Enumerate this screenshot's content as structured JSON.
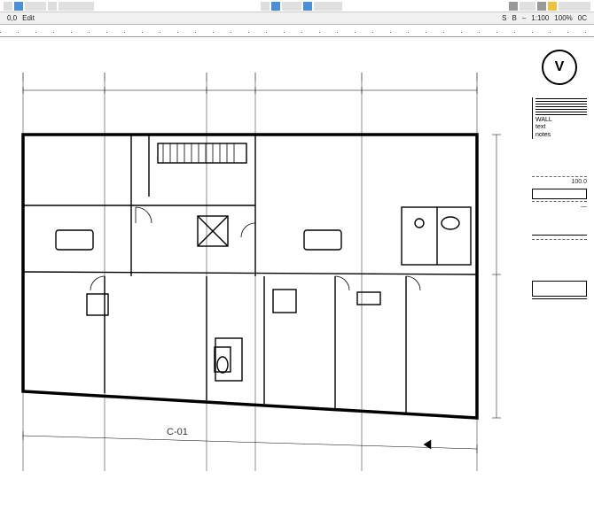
{
  "toolbar": {
    "group1": "file-ops",
    "group2": "view-ops",
    "group3": "zoom-ops"
  },
  "ribbon": {
    "coords": "0,0",
    "mode": "Edit",
    "scale_hint": "1:100",
    "zoom": "100%",
    "tool1": "S",
    "tool2": "B",
    "page_label": "0C"
  },
  "drawing": {
    "title_block": "C-01",
    "north_symbol": "V"
  },
  "legend": {
    "hatch_label": "WALL",
    "line1": "text",
    "line2": "notes"
  },
  "schedule": {
    "r1": "100.0",
    "r2": "—",
    "r3": " ",
    "r4": " "
  }
}
